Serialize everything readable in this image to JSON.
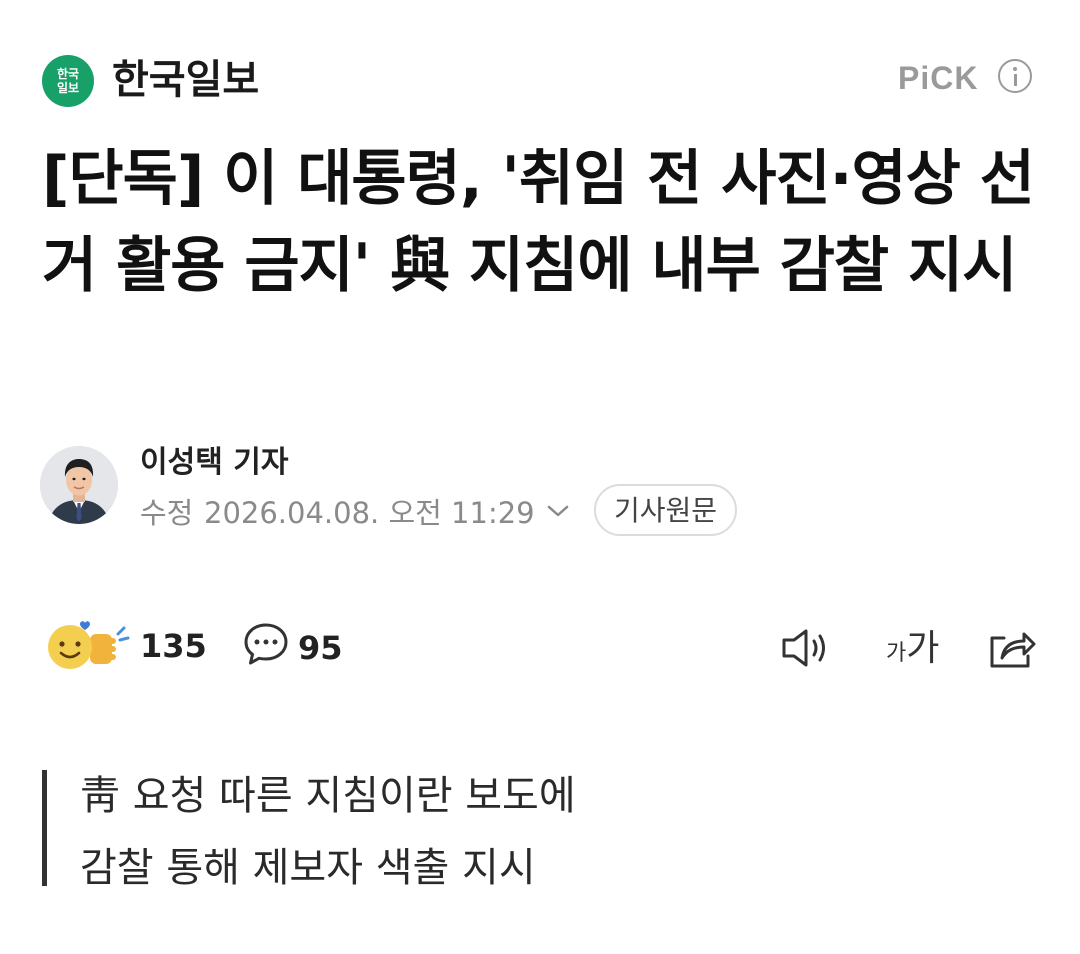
{
  "header": {
    "press_logo_text": "한국일보",
    "press_name": "한국일보",
    "pick_label": "PiCK"
  },
  "article": {
    "headline": "[단독] 이 대통령, '취임 전 사진·영상 선거 활용 금지' 與 지침에 내부 감찰 지시",
    "reporter": "이성택 기자",
    "modified_label": "수정",
    "modified_datetime": "2026.04.08. 오전 11:29",
    "original_button": "기사원문"
  },
  "reactions": {
    "like_count": "135",
    "comment_count": "95",
    "font_size_small": "가",
    "font_size_large": "가"
  },
  "summary": {
    "line1": "靑 요청 따른 지침이란 보도에",
    "line2": "감찰 통해 제보자 색출 지시"
  },
  "colors": {
    "logo_green": "#17a169",
    "muted_gray": "#8a8a8a",
    "emoji_yellow": "#f4cf4f"
  },
  "icons": [
    "info-icon",
    "reporter-photo",
    "chevron-down-icon",
    "reaction-emoji-icon",
    "comment-icon",
    "speaker-icon",
    "share-icon"
  ]
}
